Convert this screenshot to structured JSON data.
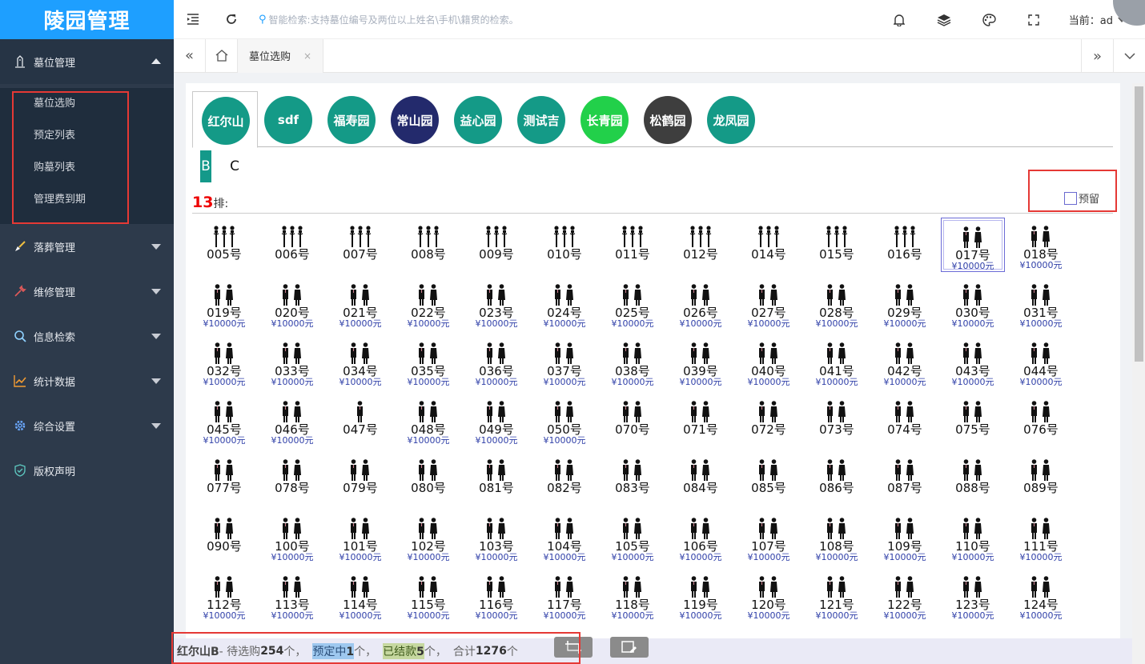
{
  "app": {
    "title": "陵园管理"
  },
  "sidebar": {
    "groups": [
      {
        "label": "墓位管理",
        "icon": "monument-icon",
        "expanded": true,
        "items": [
          "墓位选购",
          "预定列表",
          "购墓列表",
          "管理费到期"
        ]
      },
      {
        "label": "落葬管理",
        "icon": "shovel-icon"
      },
      {
        "label": "维修管理",
        "icon": "wrench-icon"
      },
      {
        "label": "信息检索",
        "icon": "search-icon"
      },
      {
        "label": "统计数据",
        "icon": "line-chart-icon"
      },
      {
        "label": "综合设置",
        "icon": "gear-icon"
      },
      {
        "label": "版权声明",
        "icon": "shield-check-icon"
      }
    ]
  },
  "topbar": {
    "search_placeholder": "智能检索:支持墓位编号及两位以上姓名\\手机\\籍贯的检索。",
    "user_label": "当前：ad"
  },
  "tabs": {
    "active": "墓位选购",
    "close": "×"
  },
  "parks": [
    {
      "name": "红尔山",
      "color": "#149a87",
      "active": true
    },
    {
      "name": "sdf",
      "color": "#149a87"
    },
    {
      "name": "福寿园",
      "color": "#149a87"
    },
    {
      "name": "常山园",
      "color": "#232a6c"
    },
    {
      "name": "益心园",
      "color": "#149a87"
    },
    {
      "name": "测试吉",
      "color": "#149a87"
    },
    {
      "name": "长青园",
      "color": "#22d04a"
    },
    {
      "name": "松鹤园",
      "color": "#3e3e3e"
    },
    {
      "name": "龙凤园",
      "color": "#149a87"
    }
  ],
  "zones": [
    {
      "name": "B",
      "active": true
    },
    {
      "name": "C"
    }
  ],
  "row": {
    "number": "13",
    "suffix": "排:"
  },
  "reserve_label": "预留",
  "graves": [
    [
      "005号",
      "f3",
      ""
    ],
    [
      "006号",
      "f3",
      ""
    ],
    [
      "007号",
      "f3",
      ""
    ],
    [
      "008号",
      "f3",
      ""
    ],
    [
      "009号",
      "f3",
      ""
    ],
    [
      "010号",
      "f3",
      ""
    ],
    [
      "011号",
      "f3",
      ""
    ],
    [
      "012号",
      "f3",
      ""
    ],
    [
      "014号",
      "f3",
      ""
    ],
    [
      "015号",
      "f3",
      ""
    ],
    [
      "016号",
      "f3",
      ""
    ],
    [
      "017号",
      "c2",
      "¥10000元",
      "sel"
    ],
    [
      "018号",
      "c2",
      "¥10000元"
    ],
    [
      "019号",
      "c2",
      "¥10000元"
    ],
    [
      "020号",
      "c2",
      "¥10000元"
    ],
    [
      "021号",
      "c2",
      "¥10000元"
    ],
    [
      "022号",
      "c2",
      "¥10000元"
    ],
    [
      "023号",
      "c2",
      "¥10000元"
    ],
    [
      "024号",
      "c2",
      "¥10000元"
    ],
    [
      "025号",
      "c2",
      "¥10000元"
    ],
    [
      "026号",
      "c2",
      "¥10000元"
    ],
    [
      "027号",
      "c2",
      "¥10000元"
    ],
    [
      "028号",
      "c2",
      "¥10000元"
    ],
    [
      "029号",
      "c2",
      "¥10000元"
    ],
    [
      "030号",
      "c2",
      "¥10000元"
    ],
    [
      "031号",
      "c2",
      "¥10000元"
    ],
    [
      "032号",
      "c2",
      "¥10000元"
    ],
    [
      "033号",
      "c2",
      "¥10000元"
    ],
    [
      "034号",
      "c2",
      "¥10000元"
    ],
    [
      "035号",
      "c2",
      "¥10000元"
    ],
    [
      "036号",
      "c2",
      "¥10000元"
    ],
    [
      "037号",
      "c2",
      "¥10000元"
    ],
    [
      "038号",
      "c2",
      "¥10000元"
    ],
    [
      "039号",
      "c2",
      "¥10000元"
    ],
    [
      "040号",
      "c2",
      "¥10000元"
    ],
    [
      "041号",
      "c2",
      "¥10000元"
    ],
    [
      "042号",
      "c2",
      "¥10000元"
    ],
    [
      "043号",
      "c2",
      "¥10000元"
    ],
    [
      "044号",
      "c2",
      "¥10000元"
    ],
    [
      "045号",
      "c2",
      "¥10000元"
    ],
    [
      "046号",
      "c2",
      "¥10000元"
    ],
    [
      "047号",
      "s1",
      ""
    ],
    [
      "048号",
      "c2",
      "¥10000元"
    ],
    [
      "049号",
      "c2",
      "¥10000元"
    ],
    [
      "050号",
      "c2",
      "¥10000元"
    ],
    [
      "070号",
      "c2",
      ""
    ],
    [
      "071号",
      "c2",
      ""
    ],
    [
      "072号",
      "c2",
      ""
    ],
    [
      "073号",
      "c2",
      ""
    ],
    [
      "074号",
      "c2",
      ""
    ],
    [
      "075号",
      "c2",
      ""
    ],
    [
      "076号",
      "c2",
      ""
    ],
    [
      "077号",
      "c2",
      ""
    ],
    [
      "078号",
      "c2",
      ""
    ],
    [
      "079号",
      "c2",
      ""
    ],
    [
      "080号",
      "c2",
      ""
    ],
    [
      "081号",
      "c2",
      ""
    ],
    [
      "082号",
      "c2",
      ""
    ],
    [
      "083号",
      "c2",
      ""
    ],
    [
      "084号",
      "c2",
      ""
    ],
    [
      "085号",
      "c2",
      ""
    ],
    [
      "086号",
      "c2",
      ""
    ],
    [
      "087号",
      "c2",
      ""
    ],
    [
      "088号",
      "c2",
      ""
    ],
    [
      "089号",
      "c2",
      ""
    ],
    [
      "090号",
      "c2",
      ""
    ],
    [
      "100号",
      "c2",
      "¥10000元"
    ],
    [
      "101号",
      "c2",
      "¥10000元"
    ],
    [
      "102号",
      "c2",
      "¥10000元"
    ],
    [
      "103号",
      "c2",
      "¥10000元"
    ],
    [
      "104号",
      "c2",
      "¥10000元"
    ],
    [
      "105号",
      "c2",
      "¥10000元"
    ],
    [
      "106号",
      "c2",
      "¥10000元"
    ],
    [
      "107号",
      "c2",
      "¥10000元"
    ],
    [
      "108号",
      "c2",
      "¥10000元"
    ],
    [
      "109号",
      "c2",
      "¥10000元"
    ],
    [
      "110号",
      "c2",
      "¥10000元"
    ],
    [
      "111号",
      "c2",
      "¥10000元"
    ],
    [
      "112号",
      "c2",
      "¥10000元"
    ],
    [
      "113号",
      "c2",
      "¥10000元"
    ],
    [
      "114号",
      "c2",
      "¥10000元"
    ],
    [
      "115号",
      "c2",
      "¥10000元"
    ],
    [
      "116号",
      "c2",
      "¥10000元"
    ],
    [
      "117号",
      "c2",
      "¥10000元"
    ],
    [
      "118号",
      "c2",
      "¥10000元"
    ],
    [
      "119号",
      "c2",
      "¥10000元"
    ],
    [
      "120号",
      "c2",
      "¥10000元"
    ],
    [
      "121号",
      "c2",
      "¥10000元"
    ],
    [
      "122号",
      "c2",
      "¥10000元"
    ],
    [
      "123号",
      "c2",
      "¥10000元"
    ],
    [
      "124号",
      "c2",
      "¥10000元"
    ]
  ],
  "footer": {
    "name": "红尔山B",
    "t1": " - 待选购",
    "pending": "254",
    "t2": "个，",
    "reserved_text": "预定中",
    "reserved": "1",
    "t3": "个，",
    "paid_text": "已结款",
    "paid": "5",
    "t4": "个，",
    "total_text": "合计",
    "total": "1276",
    "t5": "个"
  },
  "colors": {
    "accent": "#1e9fff",
    "sidebar": "#2d3a4b",
    "highlight": "#e53935"
  }
}
